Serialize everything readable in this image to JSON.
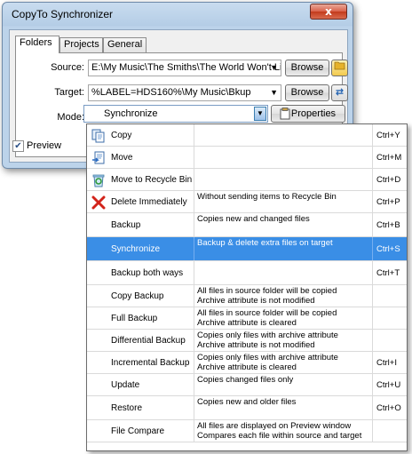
{
  "window": {
    "title": "CopyTo Synchronizer",
    "close_label": "x"
  },
  "tabs": [
    "Folders",
    "Projects",
    "General"
  ],
  "form": {
    "source_label": "Source:",
    "source_value": "E:\\My Music\\The Smiths\\The World Won't Lister",
    "target_label": "Target:",
    "target_value": "%LABEL=HDS160%\\My Music\\Bkup",
    "mode_label": "Mode:",
    "mode_value": "Synchronize",
    "browse_label": "Browse",
    "properties_label": "Properties",
    "preview_label": "Preview",
    "preview_checked": true
  },
  "modes": [
    {
      "name": "Copy",
      "desc": [
        "",
        ""
      ],
      "key": "Ctrl+Y",
      "icon": "copy-icon"
    },
    {
      "name": "Move",
      "desc": [
        "",
        ""
      ],
      "key": "Ctrl+M",
      "icon": "move-icon"
    },
    {
      "name": "Move to Recycle Bin",
      "desc": [
        "",
        ""
      ],
      "key": "Ctrl+D",
      "icon": "recycle-bin-icon"
    },
    {
      "name": "Delete Immediately",
      "desc": [
        "Without sending items to Recycle Bin",
        ""
      ],
      "key": "Ctrl+P",
      "icon": "delete-icon"
    },
    {
      "name": "Backup",
      "desc": [
        "Copies new and changed files",
        ""
      ],
      "key": "Ctrl+B",
      "icon": ""
    },
    {
      "name": "Synchronize",
      "desc": [
        "Backup & delete extra files on target",
        ""
      ],
      "key": "Ctrl+S",
      "icon": "",
      "selected": true
    },
    {
      "name": "Backup both ways",
      "desc": [
        "",
        ""
      ],
      "key": "Ctrl+T",
      "icon": ""
    },
    {
      "name": "Copy Backup",
      "desc": [
        "All files in source folder will be copied",
        "Archive attribute is not modified"
      ],
      "key": "",
      "icon": ""
    },
    {
      "name": "Full Backup",
      "desc": [
        "All files in source folder will be copied",
        "Archive attribute is cleared"
      ],
      "key": "",
      "icon": ""
    },
    {
      "name": "Differential Backup",
      "desc": [
        "Copies only files with archive attribute",
        "Archive attribute is not modified"
      ],
      "key": "",
      "icon": ""
    },
    {
      "name": "Incremental Backup",
      "desc": [
        "Copies only files with archive attribute",
        "Archive attribute is cleared"
      ],
      "key": "Ctrl+I",
      "icon": ""
    },
    {
      "name": "Update",
      "desc": [
        "Copies changed files only",
        ""
      ],
      "key": "Ctrl+U",
      "icon": ""
    },
    {
      "name": "Restore",
      "desc": [
        "Copies new and older files",
        ""
      ],
      "key": "Ctrl+O",
      "icon": ""
    },
    {
      "name": "File Compare",
      "desc": [
        "All files are displayed on Preview window",
        "Compares each file within source and target"
      ],
      "key": "",
      "icon": ""
    }
  ],
  "colors": {
    "selection": "#3a8ee6",
    "close_button": "#c23b1c",
    "window_frame": "#bcd3ea"
  }
}
